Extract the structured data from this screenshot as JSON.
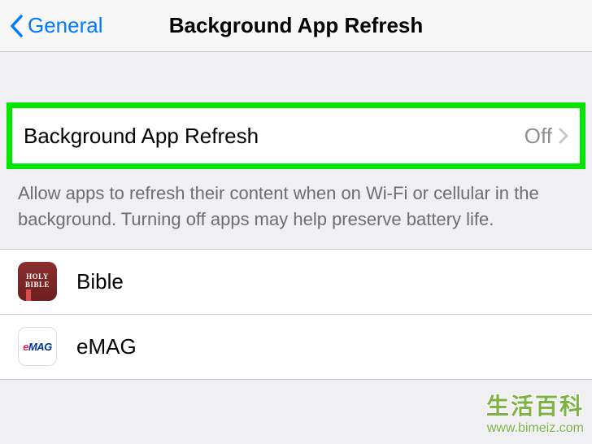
{
  "nav": {
    "back_label": "General",
    "title": "Background App Refresh"
  },
  "main_setting": {
    "label": "Background App Refresh",
    "value": "Off"
  },
  "footer": {
    "description": "Allow apps to refresh their content when on Wi-Fi or cellular in the background. Turning off apps may help preserve battery life."
  },
  "apps": [
    {
      "name": "Bible",
      "icon_line1": "HOLY",
      "icon_line2": "BIBLE"
    },
    {
      "name": "eMAG",
      "icon_prefix": "e",
      "icon_suffix": "MAG"
    }
  ],
  "watermark": {
    "title": "生活百科",
    "url": "www.bimeiz.com"
  }
}
